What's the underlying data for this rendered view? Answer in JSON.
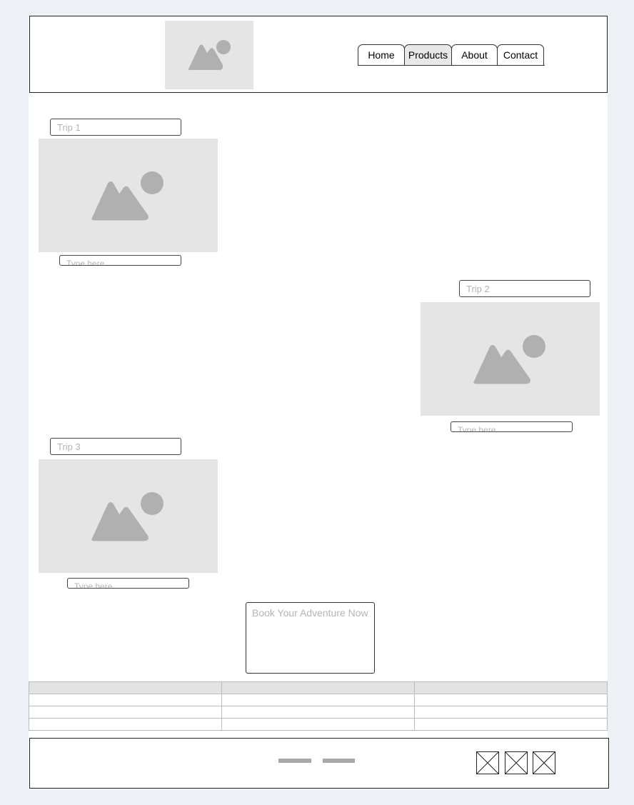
{
  "nav": {
    "tabs": [
      {
        "label": "Home"
      },
      {
        "label": "Products"
      },
      {
        "label": "About"
      },
      {
        "label": "Contact"
      }
    ],
    "active": "Products"
  },
  "trips": [
    {
      "title_placeholder": "Trip 1",
      "caption_placeholder": "Type here"
    },
    {
      "title_placeholder": "Trip 2",
      "caption_placeholder": "Type here"
    },
    {
      "title_placeholder": "Trip 3",
      "caption_placeholder": "Type here"
    }
  ],
  "cta": {
    "placeholder": "Book Your Adventure Now"
  },
  "table": {
    "columns": [
      "",
      "",
      ""
    ],
    "rows": [
      [
        "",
        "",
        ""
      ],
      [
        "",
        "",
        ""
      ],
      [
        "",
        "",
        ""
      ]
    ]
  },
  "footer": {
    "links": [
      "link-1",
      "link-2"
    ],
    "icons": [
      "placeholder-box-icon",
      "placeholder-box-icon",
      "placeholder-box-icon"
    ]
  },
  "colors": {
    "background": "#edf0f4",
    "placeholder_fill": "#e5e5e5",
    "placeholder_shape": "#b0b0b0",
    "placeholder_text": "#b5b5b5",
    "active_tab": "#e8e8e8"
  }
}
